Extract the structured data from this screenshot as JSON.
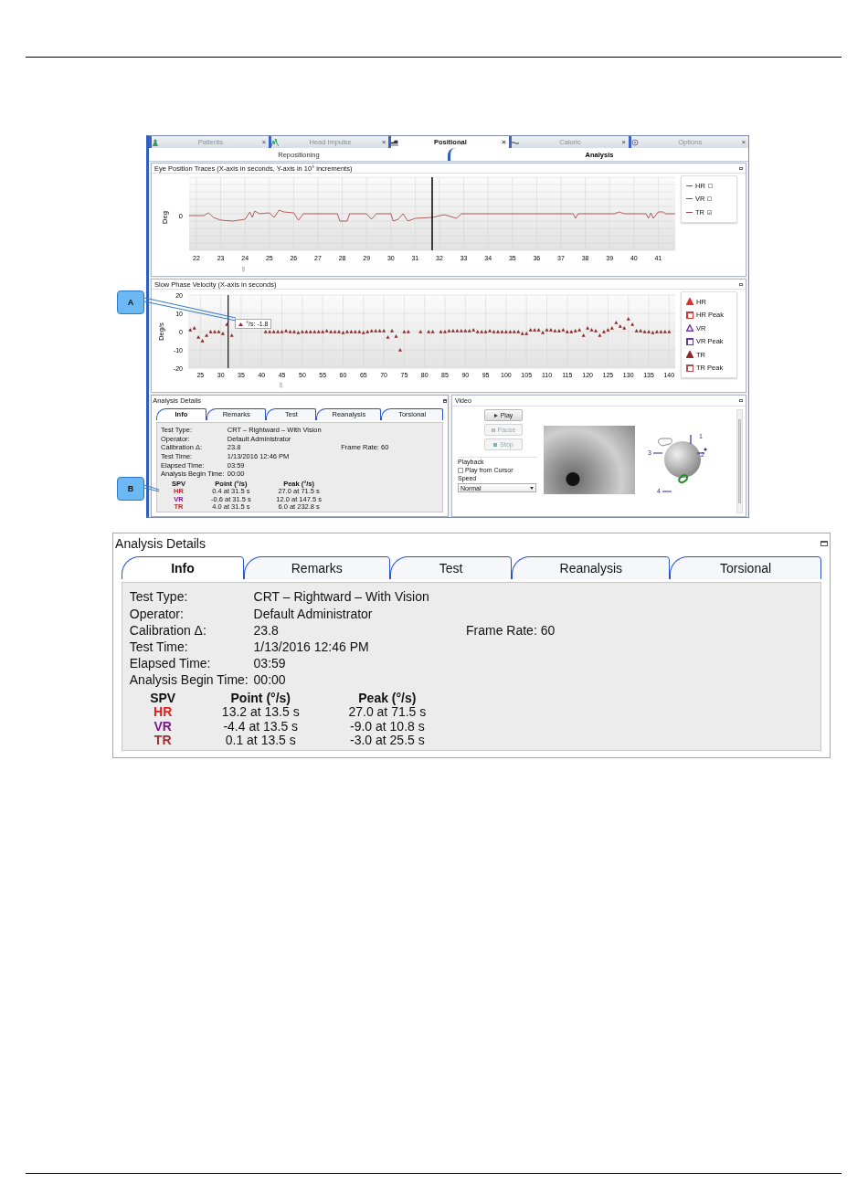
{
  "screenshot": {
    "tabs": [
      {
        "label": "Patients",
        "close": "×",
        "selected": false
      },
      {
        "label": "Head Impulse",
        "close": "×",
        "selected": false
      },
      {
        "label": "Positional",
        "close": "×",
        "selected": true
      },
      {
        "label": "Caloric",
        "close": "×",
        "selected": false
      },
      {
        "label": "Options",
        "close": "×",
        "selected": false
      }
    ],
    "subtabs": [
      {
        "label": "Repositioning",
        "selected": false
      },
      {
        "label": "Analysis",
        "selected": true
      }
    ],
    "eye_position": {
      "title": "Eye Position Traces (X-axis in seconds, Y-axis in 10° increments)",
      "ylabel": "Deg",
      "ytick": "0",
      "xticks": [
        "22",
        "23",
        "24",
        "25",
        "26",
        "27",
        "28",
        "29",
        "30",
        "31",
        "32",
        "33",
        "34",
        "35",
        "36",
        "37",
        "38",
        "39",
        "40",
        "41"
      ],
      "legend": [
        {
          "label": "HR",
          "checked": false
        },
        {
          "label": "VR",
          "checked": false
        },
        {
          "label": "TR",
          "checked": true
        }
      ]
    },
    "slow_phase": {
      "chart_data": {
        "type": "scatter",
        "title": "Slow Phase Velocity (X-axis in seconds)",
        "ylabel": "Deg/s",
        "xlim": [
          22,
          141.5
        ],
        "ylim": [
          -20,
          20
        ],
        "xticks": [
          25,
          30,
          35,
          40,
          45,
          50,
          55,
          60,
          65,
          70,
          75,
          80,
          85,
          90,
          95,
          100,
          105,
          110,
          115,
          120,
          125,
          130,
          135,
          140
        ],
        "yticks": [
          -20,
          -10,
          0,
          10,
          20
        ],
        "grid": true,
        "ref_lines": [
          {
            "axis": "x",
            "value": 31.8
          }
        ],
        "x": [
          22.5,
          23.5,
          24.5,
          25.5,
          26.5,
          27.5,
          28.5,
          29.5,
          30.5,
          31.5,
          32.7,
          41,
          42,
          43,
          44,
          45,
          46,
          47,
          48,
          49,
          50,
          51,
          52,
          53,
          54,
          55,
          56,
          57,
          58,
          59,
          60,
          61,
          62,
          63,
          64,
          65,
          66,
          67,
          68,
          69,
          70,
          71,
          72,
          73,
          74,
          75,
          76,
          79,
          81,
          82,
          84,
          85,
          86,
          87,
          88,
          89,
          90,
          91,
          92,
          93,
          94,
          95,
          96,
          97,
          98,
          99,
          100,
          101,
          102,
          103,
          104,
          105,
          106,
          107,
          108,
          109,
          110,
          111,
          112,
          113,
          114,
          115,
          116,
          117,
          118,
          119,
          120,
          121,
          122,
          123,
          124,
          125,
          126,
          127,
          128,
          129,
          130,
          131,
          132,
          133,
          134,
          135,
          136,
          137,
          138,
          139,
          140
        ],
        "series": [
          {
            "color": "#8b2b2b",
            "values": [
              1,
              2,
              -3,
              -5,
              -2,
              0,
              0,
              0,
              -1,
              4,
              -2,
              0,
              0,
              0,
              0,
              0,
              0.5,
              0,
              0,
              -0.5,
              0,
              0,
              0,
              0,
              0,
              0,
              0.5,
              0,
              0,
              0,
              -0.5,
              0,
              0,
              0,
              0,
              -0.5,
              0,
              0.5,
              0.5,
              0.5,
              0.5,
              -3,
              0.5,
              -2.5,
              -10,
              0,
              0,
              0,
              0,
              0,
              0,
              0,
              0.5,
              0.5,
              0.5,
              0.5,
              0.5,
              0.5,
              1,
              0,
              0,
              0,
              0.5,
              0,
              0,
              0,
              0,
              0,
              0,
              0,
              -1,
              -1,
              1,
              1,
              1,
              -0.5,
              1,
              1,
              0.5,
              0.5,
              1,
              0,
              0,
              0.5,
              1,
              -2,
              2,
              1,
              0.5,
              -2,
              0,
              1,
              2,
              5,
              3,
              2,
              7,
              4,
              0.5,
              0.5,
              0,
              0,
              -0.5,
              0,
              0,
              0,
              0
            ]
          }
        ]
      },
      "tooltip": "°/s: -1.8",
      "legend": [
        {
          "label": "HR",
          "kind": "triangle",
          "filled": true,
          "color": "#e03030"
        },
        {
          "label": "HR Peak",
          "kind": "square",
          "filled": false,
          "color": "#d03434"
        },
        {
          "label": "VR",
          "kind": "triangle",
          "filled": false,
          "color": "#7a3aa8"
        },
        {
          "label": "VR Peak",
          "kind": "square",
          "filled": false,
          "color": "#6a3a98"
        },
        {
          "label": "TR",
          "kind": "triangle",
          "filled": true,
          "color": "#8b2b2b"
        },
        {
          "label": "TR Peak",
          "kind": "square",
          "filled": false,
          "color": "#b05050"
        }
      ]
    },
    "analysis_details": {
      "title": "Analysis Details",
      "tabs": [
        {
          "label": "Info",
          "selected": true
        },
        {
          "label": "Remarks",
          "selected": false
        },
        {
          "label": "Test",
          "selected": false
        },
        {
          "label": "Reanalysis",
          "selected": false
        },
        {
          "label": "Torsional",
          "selected": false
        }
      ],
      "fields": [
        {
          "label": "Test Type:",
          "value": "CRT – Rightward – With Vision"
        },
        {
          "label": "Operator:",
          "value": "Default Administrator"
        },
        {
          "label": "Calibration Δ:",
          "value": "23.8",
          "note": "Frame Rate: 60"
        },
        {
          "label": "Test Time:",
          "value": "1/13/2016 12:46 PM"
        },
        {
          "label": "Elapsed Time:",
          "value": "03:59"
        },
        {
          "label": "Analysis Begin Time:",
          "value": "00:00"
        }
      ],
      "spv": {
        "columns": [
          "SPV",
          "Point (°/s)",
          "Peak (°/s)"
        ],
        "rows": [
          {
            "label": "HR",
            "color": "#e02020",
            "point": "0.4 at 31.5 s",
            "peak": "27.0 at 71.5 s"
          },
          {
            "label": "VR",
            "color": "#7a1a8a",
            "point": "-0.6 at 31.5 s",
            "peak": "12.0 at 147.5 s"
          },
          {
            "label": "TR",
            "color": "#a03030",
            "point": "4.0 at 31.5 s",
            "peak": "6.0 at 232.8 s"
          }
        ]
      }
    },
    "video": {
      "title": "Video",
      "buttons": [
        {
          "label": "Play",
          "disabled": false
        },
        {
          "label": "Pause",
          "disabled": true
        },
        {
          "label": "Stop",
          "disabled": true
        }
      ],
      "playback_label": "Playback",
      "play_from_cursor": {
        "label": "Play from Cursor",
        "checked": false
      },
      "speed_label": "Speed",
      "speed": "Normal",
      "axis_labels": [
        "1",
        "2",
        "3",
        "4"
      ]
    }
  },
  "callouts": [
    {
      "label": "A"
    },
    {
      "label": "B"
    }
  ],
  "analysis_details": {
    "title": "Analysis Details",
    "tabs": [
      {
        "label": "Info",
        "selected": true
      },
      {
        "label": "Remarks",
        "selected": false
      },
      {
        "label": "Test",
        "selected": false
      },
      {
        "label": "Reanalysis",
        "selected": false
      },
      {
        "label": "Torsional",
        "selected": false
      }
    ],
    "fields": [
      {
        "label": "Test Type:",
        "value": "CRT – Rightward – With Vision"
      },
      {
        "label": "Operator:",
        "value": "Default Administrator"
      },
      {
        "label": "Calibration Δ:",
        "value": "23.8",
        "note": "Frame Rate: 60"
      },
      {
        "label": "Test Time:",
        "value": "1/13/2016 12:46 PM"
      },
      {
        "label": "Elapsed Time:",
        "value": "03:59"
      },
      {
        "label": "Analysis Begin Time:",
        "value": "00:00"
      }
    ],
    "spv": {
      "columns": [
        "SPV",
        "Point (°/s)",
        "Peak (°/s)"
      ],
      "rows": [
        {
          "label": "HR",
          "color": "#e02020",
          "point": "13.2 at 13.5 s",
          "peak": "27.0 at 71.5 s"
        },
        {
          "label": "VR",
          "color": "#7a1a8a",
          "point": "-4.4 at 13.5 s",
          "peak": "-9.0 at 10.8 s"
        },
        {
          "label": "TR",
          "color": "#a03030",
          "point": "0.1 at 13.5 s",
          "peak": "-3.0 at 25.5 s"
        }
      ]
    }
  }
}
